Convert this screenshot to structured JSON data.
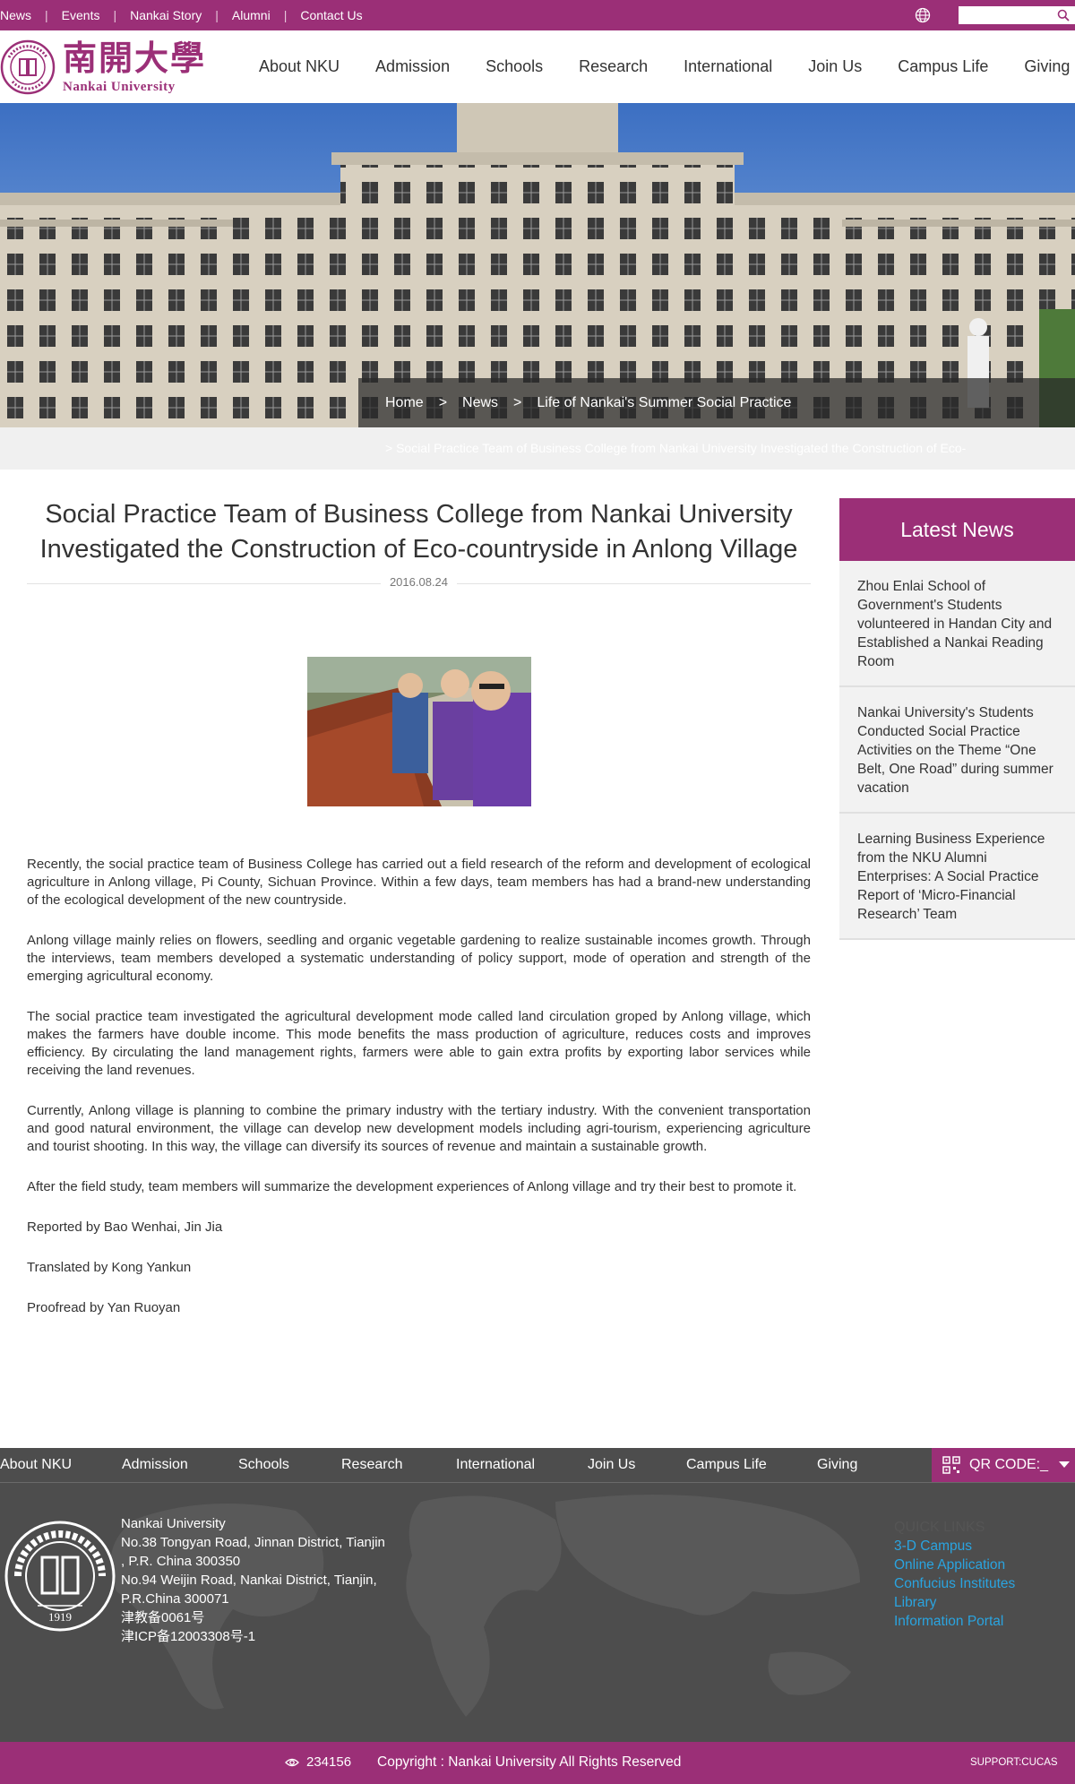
{
  "top_links": [
    "News",
    "Events",
    "Nankai Story",
    "Alumni",
    "Contact Us"
  ],
  "search": {
    "placeholder": ""
  },
  "logo": {
    "chinese": "南開大學",
    "english": "Nankai University",
    "seal_year": "1919",
    "seal_text": "NANKAI UNIVERSITY"
  },
  "main_nav": [
    "About NKU",
    "Admission",
    "Schools",
    "Research",
    "International",
    "Join Us",
    "Campus Life",
    "Giving"
  ],
  "breadcrumb": {
    "home": "Home",
    "sep": ">",
    "news": "News",
    "current": "Life of Nankai's Summer Social Practice"
  },
  "subbar_text": "> Social Practice Team of Business College from Nankai University Investigated the Construction of Eco-",
  "article": {
    "title": "Social Practice Team of Business College from Nankai University Investigated the Construction of Eco-countryside in Anlong Village",
    "date": "2016.08.24",
    "paragraphs": [
      "Recently, the social practice team of Business College has carried out a field research of the reform and development of ecological agriculture in Anlong village, Pi County, Sichuan Province. Within a few days, team members has had a brand-new understanding of the ecological development of the new countryside.",
      "Anlong village mainly relies on flowers, seedling and organic vegetable gardening to realize sustainable incomes growth. Through the interviews, team members developed a systematic understanding of policy support, mode of operation and strength of the emerging agricultural economy.",
      "The social practice team investigated the agricultural development mode called land circulation groped by Anlong village, which makes the farmers have double income. This mode benefits the mass production of agriculture, reduces costs and improves efficiency. By circulating the land management rights, farmers were able to gain extra profits by exporting labor services while receiving the land revenues.",
      "Currently, Anlong village is planning to combine the primary industry with the tertiary industry. With the convenient transportation and good natural environment, the village can develop new development models including agri-tourism, experiencing agriculture and tourist shooting. In this way, the village can diversify its sources of revenue and maintain a sustainable growth.",
      "After the field study, team members will summarize the development experiences of Anlong village and try their best to promote it.",
      "Reported by Bao Wenhai, Jin Jia",
      "Translated by Kong Yankun",
      "Proofread by Yan Ruoyan"
    ]
  },
  "sidebar": {
    "title": "Latest News",
    "items": [
      "Zhou Enlai School of Government's Students volunteered in Handan City and Established a Nankai Reading Room",
      "Nankai University's Students Conducted Social Practice Activities on the Theme “One Belt, One Road” during summer vacation",
      "Learning Business Experience from the NKU Alumni Enterprises: A Social Practice Report of ‘Micro-Financial Research’ Team"
    ]
  },
  "footer": {
    "nav": [
      "About NKU",
      "Admission",
      "Schools",
      "Research",
      "International",
      "Join Us",
      "Campus Life",
      "Giving"
    ],
    "qr_label": "QR CODE:_",
    "address_lines": [
      "Nankai University",
      "No.38 Tongyan Road, Jinnan District, Tianjin",
      ", P.R. China 300350",
      "No.94 Weijin Road,  Nankai District, Tianjin,",
      "P.R.China  300071",
      "津教备0061号",
      "津ICP备12003308号-1"
    ],
    "quick_links_title": "QUICK LINKS",
    "quick_links": [
      "3-D Campus",
      "Online Application",
      "Confucius Institutes",
      "Library",
      "Information Portal"
    ],
    "visit_count": "234156",
    "copyright": "Copyright : Nankai University All Rights Reserved",
    "support": "SUPPORT:CUCAS"
  },
  "colors": {
    "brand": "#9b2f77",
    "link": "#2aa4e0",
    "footer_bg": "#4d4d4d"
  }
}
